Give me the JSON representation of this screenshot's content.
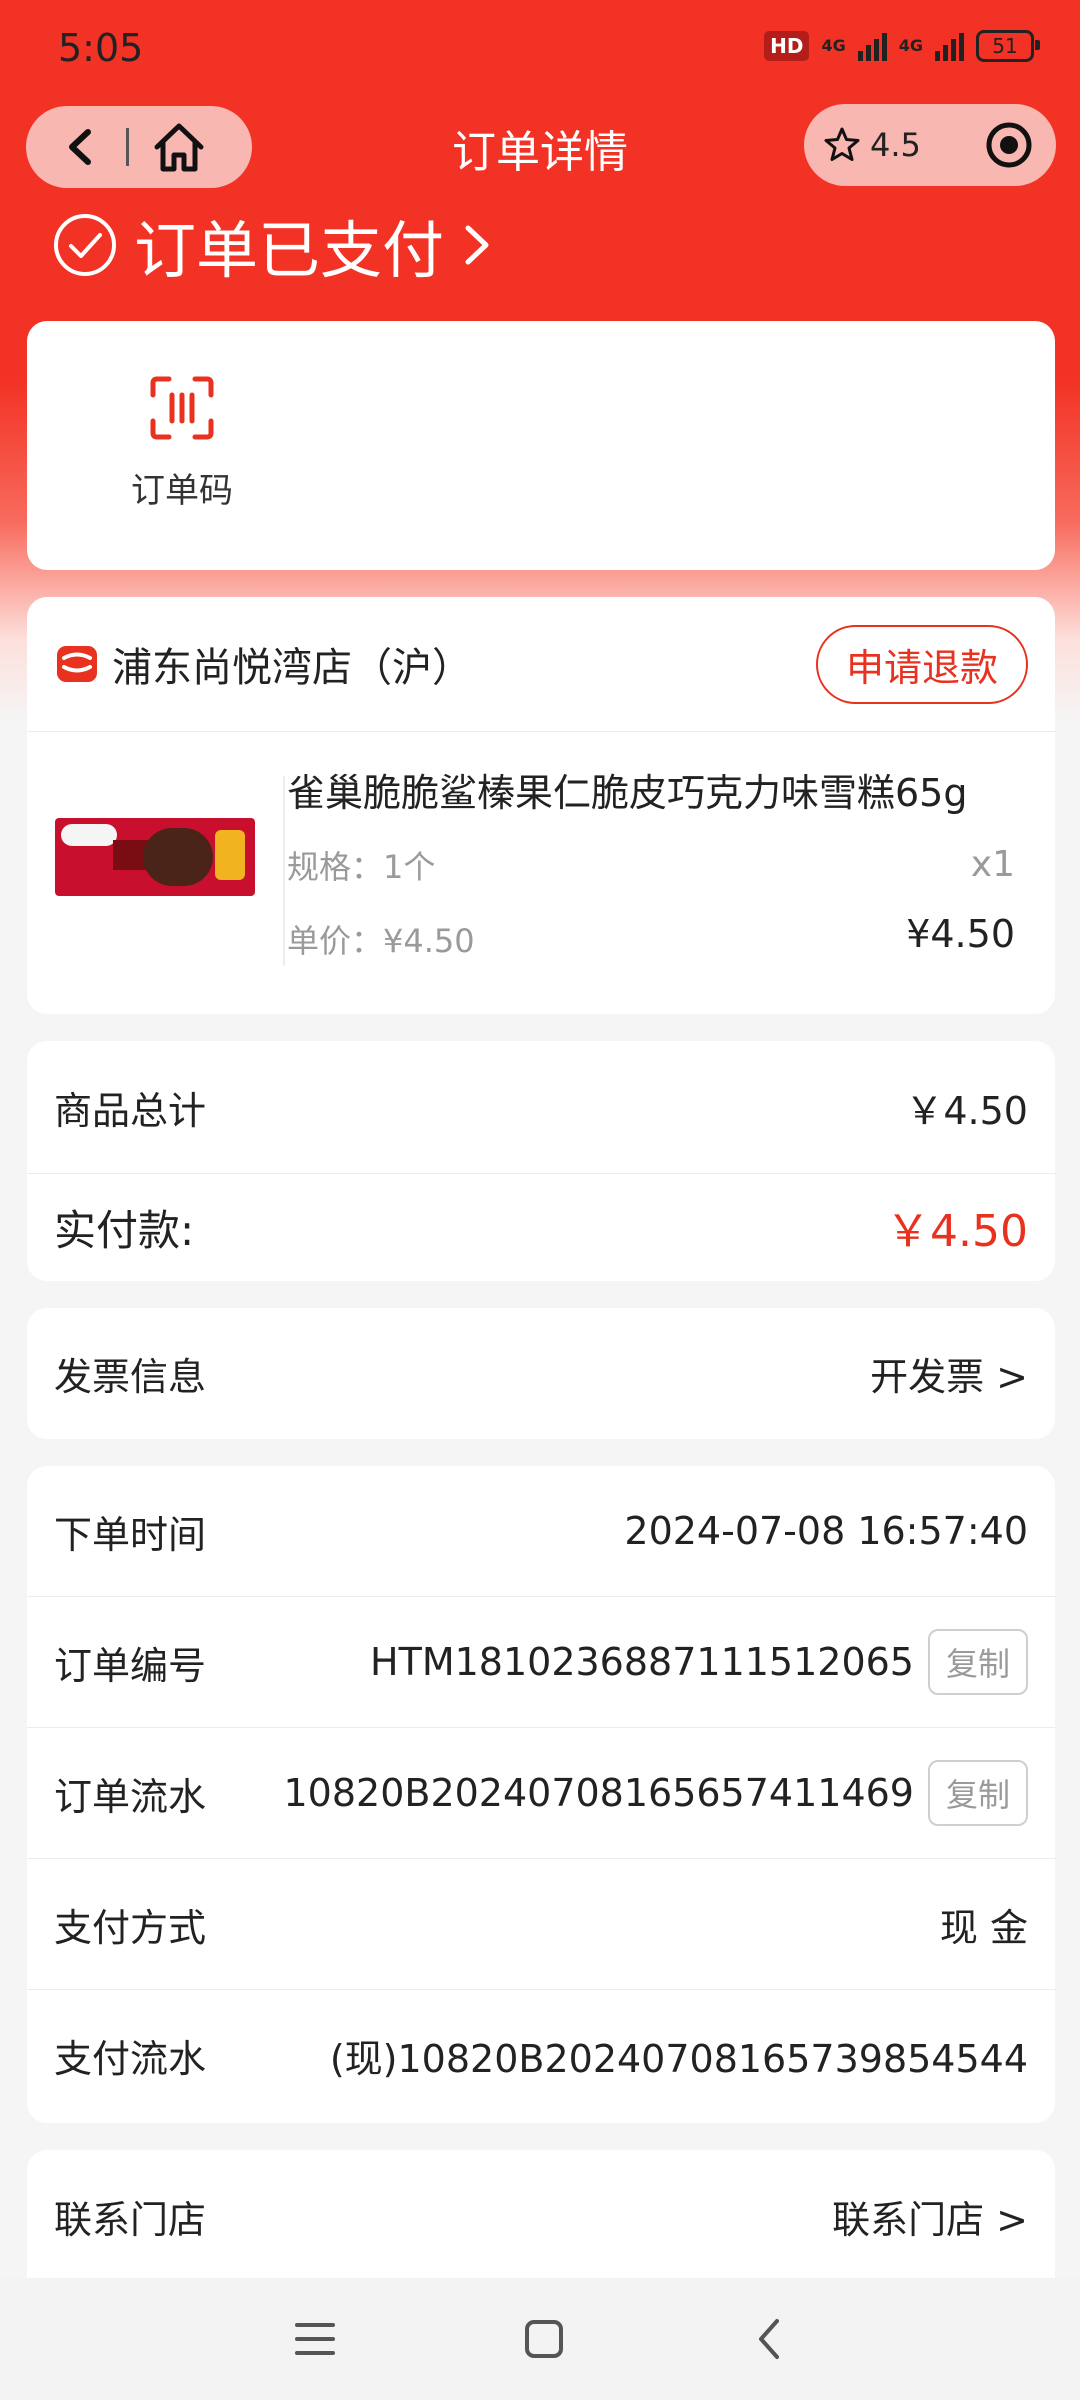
{
  "status_bar": {
    "time": "5:05",
    "hd": "HD",
    "net1": "4G",
    "net2": "4G",
    "battery": "51"
  },
  "nav": {
    "title": "订单详情",
    "rating": "4.5"
  },
  "order_status": {
    "text": "订单已支付"
  },
  "order_code": {
    "label": "订单码"
  },
  "store": {
    "name": "浦东尚悦湾店（沪）",
    "refund_button": "申请退款"
  },
  "product": {
    "name": "雀巢脆脆鲨榛果仁脆皮巧克力味雪糕65g",
    "spec": "规格：1个",
    "unit_price": "单价：¥4.50",
    "quantity": "x1",
    "price": "¥4.50"
  },
  "totals": {
    "subtotal_label": "商品总计",
    "subtotal_value": "￥4.50",
    "paid_label": "实付款:",
    "paid_value": "￥4.50"
  },
  "invoice": {
    "label": "发票信息",
    "action": "开发票 >"
  },
  "details": {
    "order_time_label": "下单时间",
    "order_time_value": "2024-07-08 16:57:40",
    "order_no_label": "订单编号",
    "order_no_value": "HTM1810236887111512065",
    "order_serial_label": "订单流水",
    "order_serial_value": "10820B20240708165657411469",
    "pay_method_label": "支付方式",
    "pay_method_value": "现 金",
    "pay_serial_label": "支付流水",
    "pay_serial_value": "(现)10820B20240708165739854544",
    "copy_label": "复制"
  },
  "contact": {
    "label": "联系门店",
    "action": "联系门店 >"
  },
  "colors": {
    "brand_red": "#f23224",
    "price_red": "#e8321f"
  },
  "icons": [
    "back-icon",
    "home-icon",
    "star-icon",
    "target-icon",
    "check-circle-icon",
    "scan-code-icon",
    "store-icon",
    "menu-icon",
    "square-icon",
    "back-chevron-icon"
  ]
}
